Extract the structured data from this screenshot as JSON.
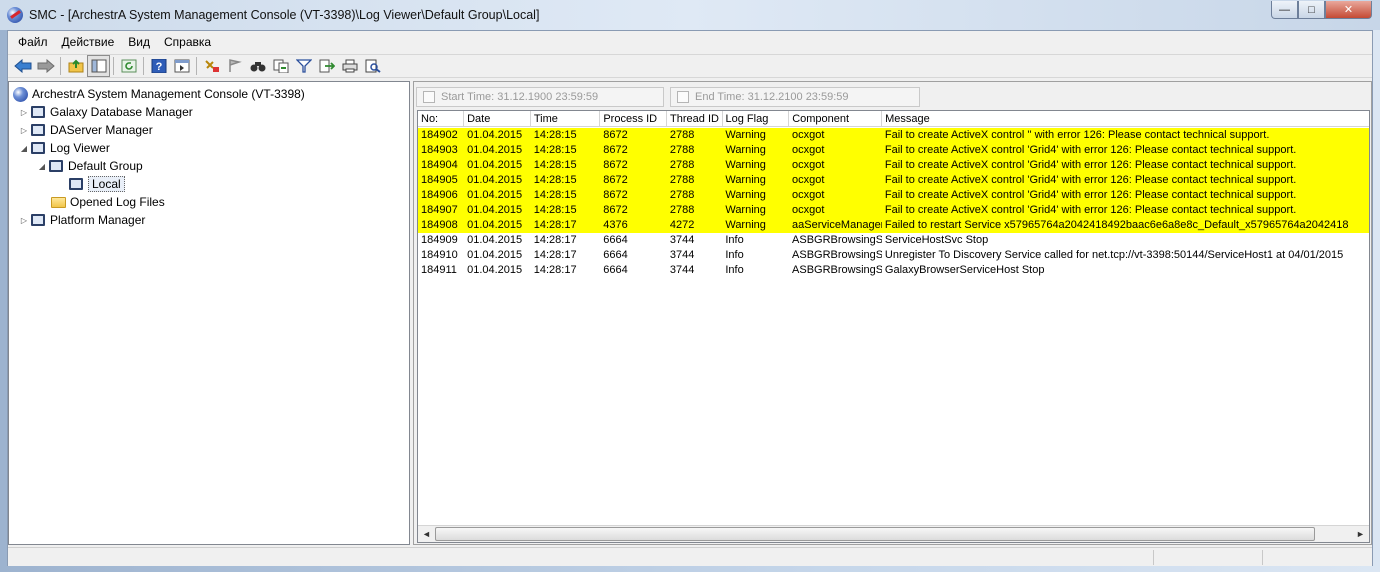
{
  "window": {
    "title": "SMC - [ArchestrA System Management Console (VT-3398)\\Log Viewer\\Default Group\\Local]",
    "minimize": "—",
    "maximize": "□",
    "close": "✕"
  },
  "menu": [
    "Файл",
    "Действие",
    "Вид",
    "Справка"
  ],
  "toolbar": {
    "icons": [
      "back-arrow-icon",
      "forward-arrow-icon",
      "up-folder-icon",
      "show-hide-tree-icon",
      "refresh-icon",
      "help-icon",
      "console-view-icon",
      "filter-icon",
      "flag-icon",
      "find-icon",
      "copy-icon",
      "funnel-icon",
      "export-icon",
      "print-icon",
      "print-preview-icon"
    ]
  },
  "tree": {
    "root": "ArchestrA System Management Console (VT-3398)",
    "items": [
      {
        "label": "Galaxy Database Manager",
        "expander": "▷"
      },
      {
        "label": "DAServer Manager",
        "expander": "▷"
      },
      {
        "label": "Log Viewer",
        "expander": "◢"
      },
      {
        "label": "Default Group",
        "expander": "◢"
      },
      {
        "label": "Local",
        "expander": ""
      },
      {
        "label": "Opened Log Files",
        "expander": ""
      },
      {
        "label": "Platform Manager",
        "expander": "▷"
      }
    ]
  },
  "filters": {
    "start_label": "Start Time: 31.12.1900   23:59:59",
    "end_label": "End Time: 31.12.2100   23:59:59"
  },
  "log": {
    "columns": [
      "No:",
      "Date",
      "Time",
      "Process ID",
      "Thread ID",
      "Log Flag",
      "Component",
      "Message"
    ],
    "highlight_color": "#ffff00",
    "rows": [
      {
        "no": "184902",
        "date": "01.04.2015",
        "time": "14:28:15",
        "pid": "8672",
        "tid": "2788",
        "flag": "Warning",
        "component": "ocxgot",
        "message": "Fail to create ActiveX control '' with error 126: Please contact technical support.",
        "warn": true
      },
      {
        "no": "184903",
        "date": "01.04.2015",
        "time": "14:28:15",
        "pid": "8672",
        "tid": "2788",
        "flag": "Warning",
        "component": "ocxgot",
        "message": "Fail to create ActiveX control 'Grid4' with error 126: Please contact technical support.",
        "warn": true
      },
      {
        "no": "184904",
        "date": "01.04.2015",
        "time": "14:28:15",
        "pid": "8672",
        "tid": "2788",
        "flag": "Warning",
        "component": "ocxgot",
        "message": "Fail to create ActiveX control 'Grid4' with error 126: Please contact technical support.",
        "warn": true
      },
      {
        "no": "184905",
        "date": "01.04.2015",
        "time": "14:28:15",
        "pid": "8672",
        "tid": "2788",
        "flag": "Warning",
        "component": "ocxgot",
        "message": "Fail to create ActiveX control 'Grid4' with error 126: Please contact technical support.",
        "warn": true
      },
      {
        "no": "184906",
        "date": "01.04.2015",
        "time": "14:28:15",
        "pid": "8672",
        "tid": "2788",
        "flag": "Warning",
        "component": "ocxgot",
        "message": "Fail to create ActiveX control 'Grid4' with error 126: Please contact technical support.",
        "warn": true
      },
      {
        "no": "184907",
        "date": "01.04.2015",
        "time": "14:28:15",
        "pid": "8672",
        "tid": "2788",
        "flag": "Warning",
        "component": "ocxgot",
        "message": "Fail to create ActiveX control 'Grid4' with error 126: Please contact technical support.",
        "warn": true
      },
      {
        "no": "184908",
        "date": "01.04.2015",
        "time": "14:28:17",
        "pid": "4376",
        "tid": "4272",
        "flag": "Warning",
        "component": "aaServiceManager",
        "message": "Failed to restart Service x57965764a2042418492baac6e6a8e8c_Default_x57965764a2042418",
        "warn": true
      },
      {
        "no": "184909",
        "date": "01.04.2015",
        "time": "14:28:17",
        "pid": "6664",
        "tid": "3744",
        "flag": "Info",
        "component": "ASBGRBrowsingSvc",
        "message": "ServiceHostSvc Stop",
        "warn": false
      },
      {
        "no": "184910",
        "date": "01.04.2015",
        "time": "14:28:17",
        "pid": "6664",
        "tid": "3744",
        "flag": "Info",
        "component": "ASBGRBrowsingSvc",
        "message": "Unregister To Discovery Service called for net.tcp://vt-3398:50144/ServiceHost1 at 04/01/2015",
        "warn": false
      },
      {
        "no": "184911",
        "date": "01.04.2015",
        "time": "14:28:17",
        "pid": "6664",
        "tid": "3744",
        "flag": "Info",
        "component": "ASBGRBrowsingSvc",
        "message": "GalaxyBrowserServiceHost Stop",
        "warn": false
      }
    ]
  },
  "scrollbar": {
    "left_arrow": "◄",
    "right_arrow": "►"
  }
}
